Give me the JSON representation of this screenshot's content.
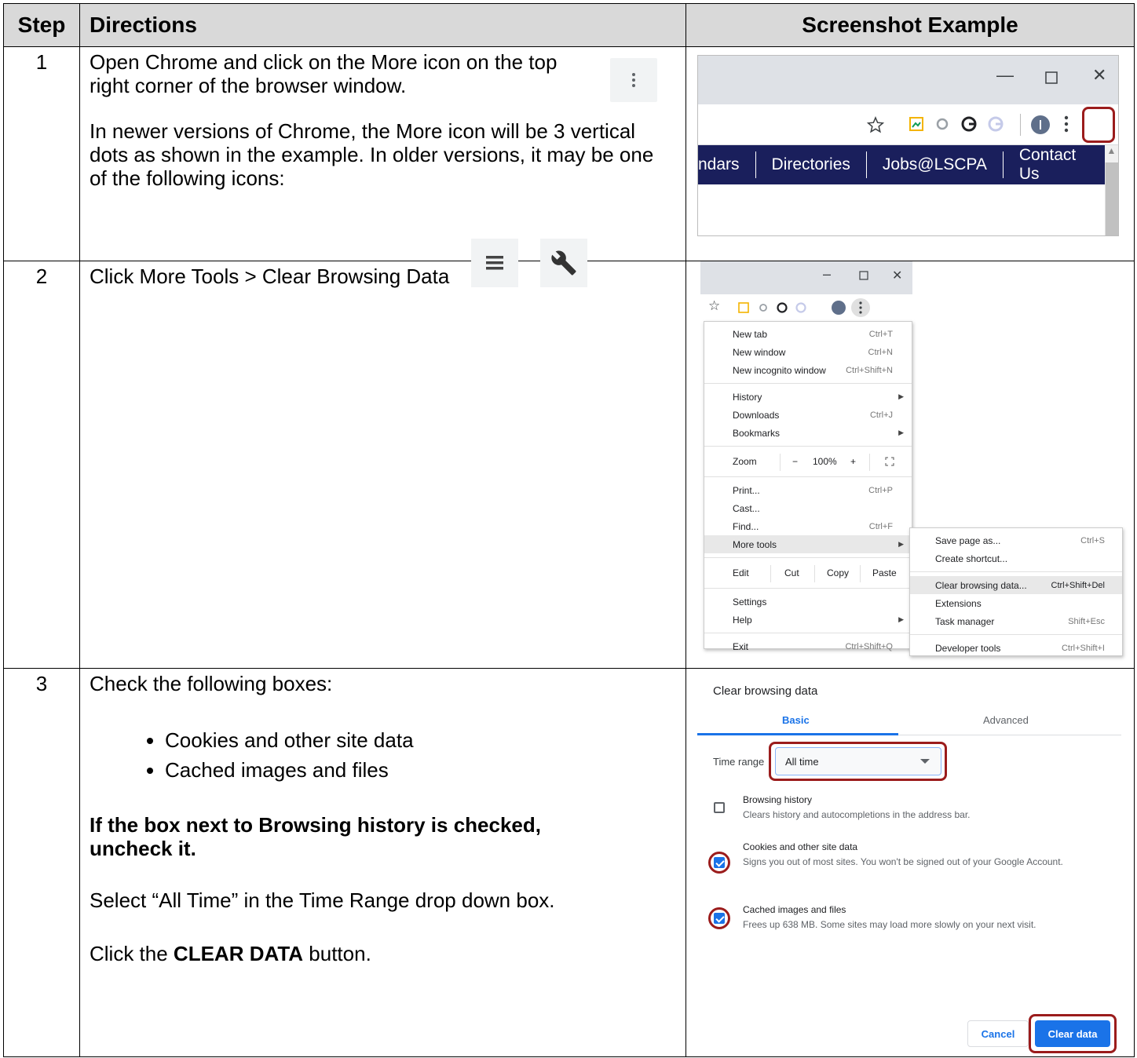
{
  "headers": {
    "step": "Step",
    "directions": "Directions",
    "screenshot": "Screenshot Example"
  },
  "steps": [
    {
      "number": "1",
      "text1": "Open Chrome and click on the More icon on the top right corner of the browser window.",
      "text2": "In newer versions of Chrome, the More icon will be 3 vertical dots as shown in the example. In older versions, it may be one of the following icons:",
      "icons": [
        "more-vert-icon",
        "hamburger-menu-icon",
        "wrench-icon"
      ],
      "screenshot": {
        "nav_items": [
          "ndars",
          "Directories",
          "Jobs@LSCPA",
          "Contact Us"
        ]
      }
    },
    {
      "number": "2",
      "text": "Click More Tools > Clear Browsing Data",
      "menu": {
        "items": [
          {
            "label": "New tab",
            "shortcut": "Ctrl+T"
          },
          {
            "label": "New window",
            "shortcut": "Ctrl+N"
          },
          {
            "label": "New incognito window",
            "shortcut": "Ctrl+Shift+N"
          }
        ],
        "items2": [
          {
            "label": "History",
            "shortcut": ""
          },
          {
            "label": "Downloads",
            "shortcut": "Ctrl+J"
          },
          {
            "label": "Bookmarks",
            "shortcut": ""
          }
        ],
        "zoom": {
          "label": "Zoom",
          "minus": "−",
          "value": "100%",
          "plus": "+"
        },
        "items3": [
          {
            "label": "Print...",
            "shortcut": "Ctrl+P"
          },
          {
            "label": "Cast...",
            "shortcut": ""
          },
          {
            "label": "Find...",
            "shortcut": "Ctrl+F"
          },
          {
            "label": "More tools",
            "shortcut": ""
          }
        ],
        "edit": {
          "label": "Edit",
          "cut": "Cut",
          "copy": "Copy",
          "paste": "Paste"
        },
        "items4": [
          {
            "label": "Settings",
            "shortcut": ""
          },
          {
            "label": "Help",
            "shortcut": ""
          }
        ],
        "exit": {
          "label": "Exit",
          "shortcut": "Ctrl+Shift+Q"
        }
      },
      "submenu": {
        "items": [
          {
            "label": "Save page as...",
            "shortcut": "Ctrl+S"
          },
          {
            "label": "Create shortcut...",
            "shortcut": ""
          }
        ],
        "items2": [
          {
            "label": "Clear browsing data...",
            "shortcut": "Ctrl+Shift+Del"
          },
          {
            "label": "Extensions",
            "shortcut": ""
          },
          {
            "label": "Task manager",
            "shortcut": "Shift+Esc"
          }
        ],
        "dev": {
          "label": "Developer tools",
          "shortcut": "Ctrl+Shift+I"
        }
      }
    },
    {
      "number": "3",
      "intro": "Check the following boxes:",
      "bullets": [
        "Cookies and other site data",
        "Cached images and files"
      ],
      "bold_note": "If the box next to Browsing history is checked, uncheck it.",
      "select_text": "Select “All Time” in the Time Range drop down box.",
      "click_pre": "Click the ",
      "click_bold": "CLEAR DATA",
      "click_post": " button.",
      "dialog": {
        "title": "Clear browsing data",
        "tab_basic": "Basic",
        "tab_advanced": "Advanced",
        "time_range_label": "Time range",
        "time_range_value": "All time",
        "options": [
          {
            "title": "Browsing history",
            "desc": "Clears history and autocompletions in the address bar.",
            "checked": false
          },
          {
            "title": "Cookies and other site data",
            "desc": "Signs you out of most sites. You won't be signed out of your Google Account.",
            "checked": true
          },
          {
            "title": "Cached images and files",
            "desc": "Frees up 638 MB. Some sites may load more slowly on your next visit.",
            "checked": true
          }
        ],
        "cancel": "Cancel",
        "clear": "Clear data"
      }
    }
  ],
  "colors": {
    "highlight_border": "#9b1c1c",
    "chrome_blue": "#1a73e8",
    "navbar": "#1a1f5c",
    "header_bg": "#d9d9d9"
  }
}
